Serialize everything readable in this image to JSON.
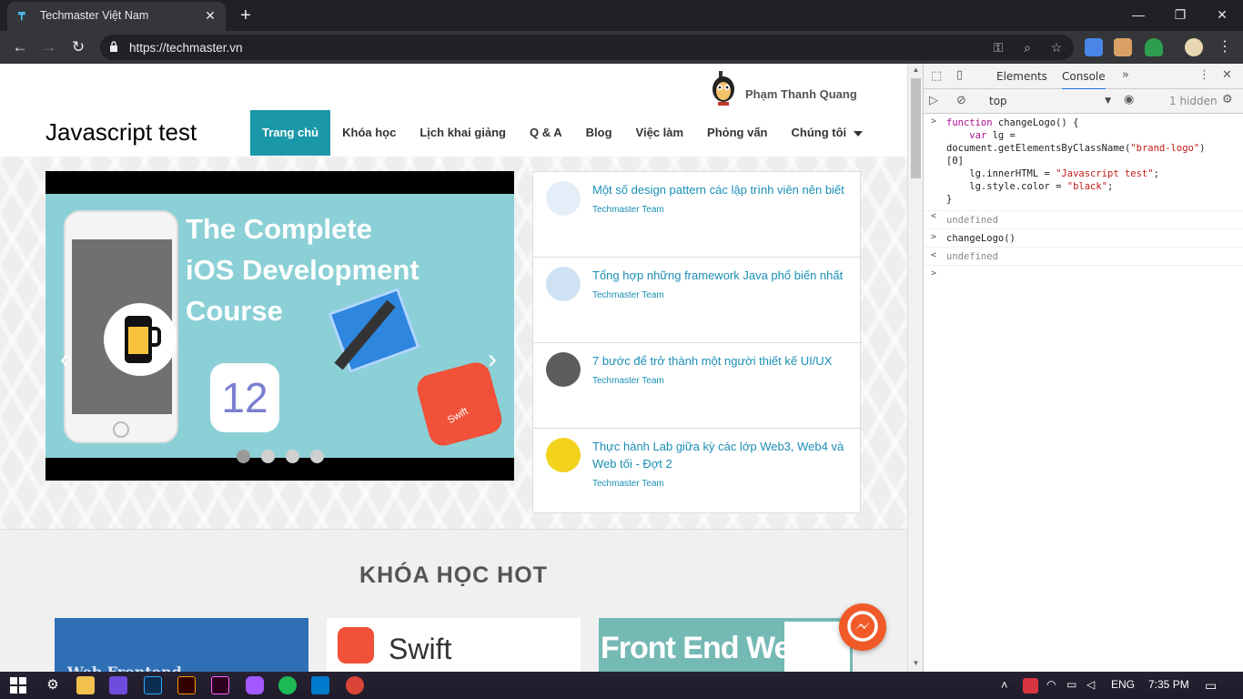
{
  "browser": {
    "tab_title": "Techmaster Việt Nam",
    "tab_close": "✕",
    "new_tab": "+",
    "url": "https://techmaster.vn"
  },
  "window_controls": {
    "minimize": "—",
    "maximize": "❐",
    "close": "✕"
  },
  "site": {
    "user_name": "Phạm Thanh Quang",
    "brand": "Javascript test",
    "nav": [
      "Trang chủ",
      "Khóa học",
      "Lịch khai giảng",
      "Q & A",
      "Blog",
      "Việc làm",
      "Phỏng vấn",
      "Chúng tôi"
    ],
    "slider": {
      "line1": "The Complete",
      "line2": "iOS Development",
      "line3": "Course",
      "ios_version": "12",
      "swift_label": "Swift",
      "prev": "‹",
      "next": "›",
      "active_slide": 1,
      "slide_count": 4
    },
    "news": [
      {
        "title": "Một số design pattern các lập trình viên nên biết",
        "author": "Techmaster Team"
      },
      {
        "title": "Tổng hợp những framework Java phổ biến nhất",
        "author": "Techmaster Team"
      },
      {
        "title": "7 bước để trở thành một người thiết kế UI/UX",
        "author": "Techmaster Team"
      },
      {
        "title": "Thực hành Lab giữa kỳ các lớp Web3, Web4 và Web tối - Đợt 2",
        "author": "Techmaster Team"
      }
    ],
    "hot_title": "KHÓA HỌC HOT",
    "cards": [
      "Web Frontend",
      "Swift",
      "Front End Web"
    ]
  },
  "devtools": {
    "tabs": [
      "Elements",
      "Console"
    ],
    "more_tabs": "»",
    "context": "top",
    "hidden": "1 hidden",
    "console_lines": [
      {
        "prompt": ">",
        "code": "function changeLogo() {\n    var lg =\ndocument.getElementsByClassName(\"brand-logo\")\n[0]\n    lg.innerHTML = \"Javascript test\";\n    lg.style.color = \"black\";\n}"
      },
      {
        "prompt": "<",
        "result": "undefined"
      },
      {
        "prompt": ">",
        "code": "changeLogo()"
      },
      {
        "prompt": "<",
        "result": "undefined"
      },
      {
        "prompt": ">",
        "code": ""
      }
    ]
  },
  "taskbar": {
    "language": "ENG",
    "time": "7:35 PM"
  },
  "colors": {
    "nav_active": "#1a98a8",
    "link": "#1a8fb5",
    "slide_bg": "#8bd0d6"
  }
}
